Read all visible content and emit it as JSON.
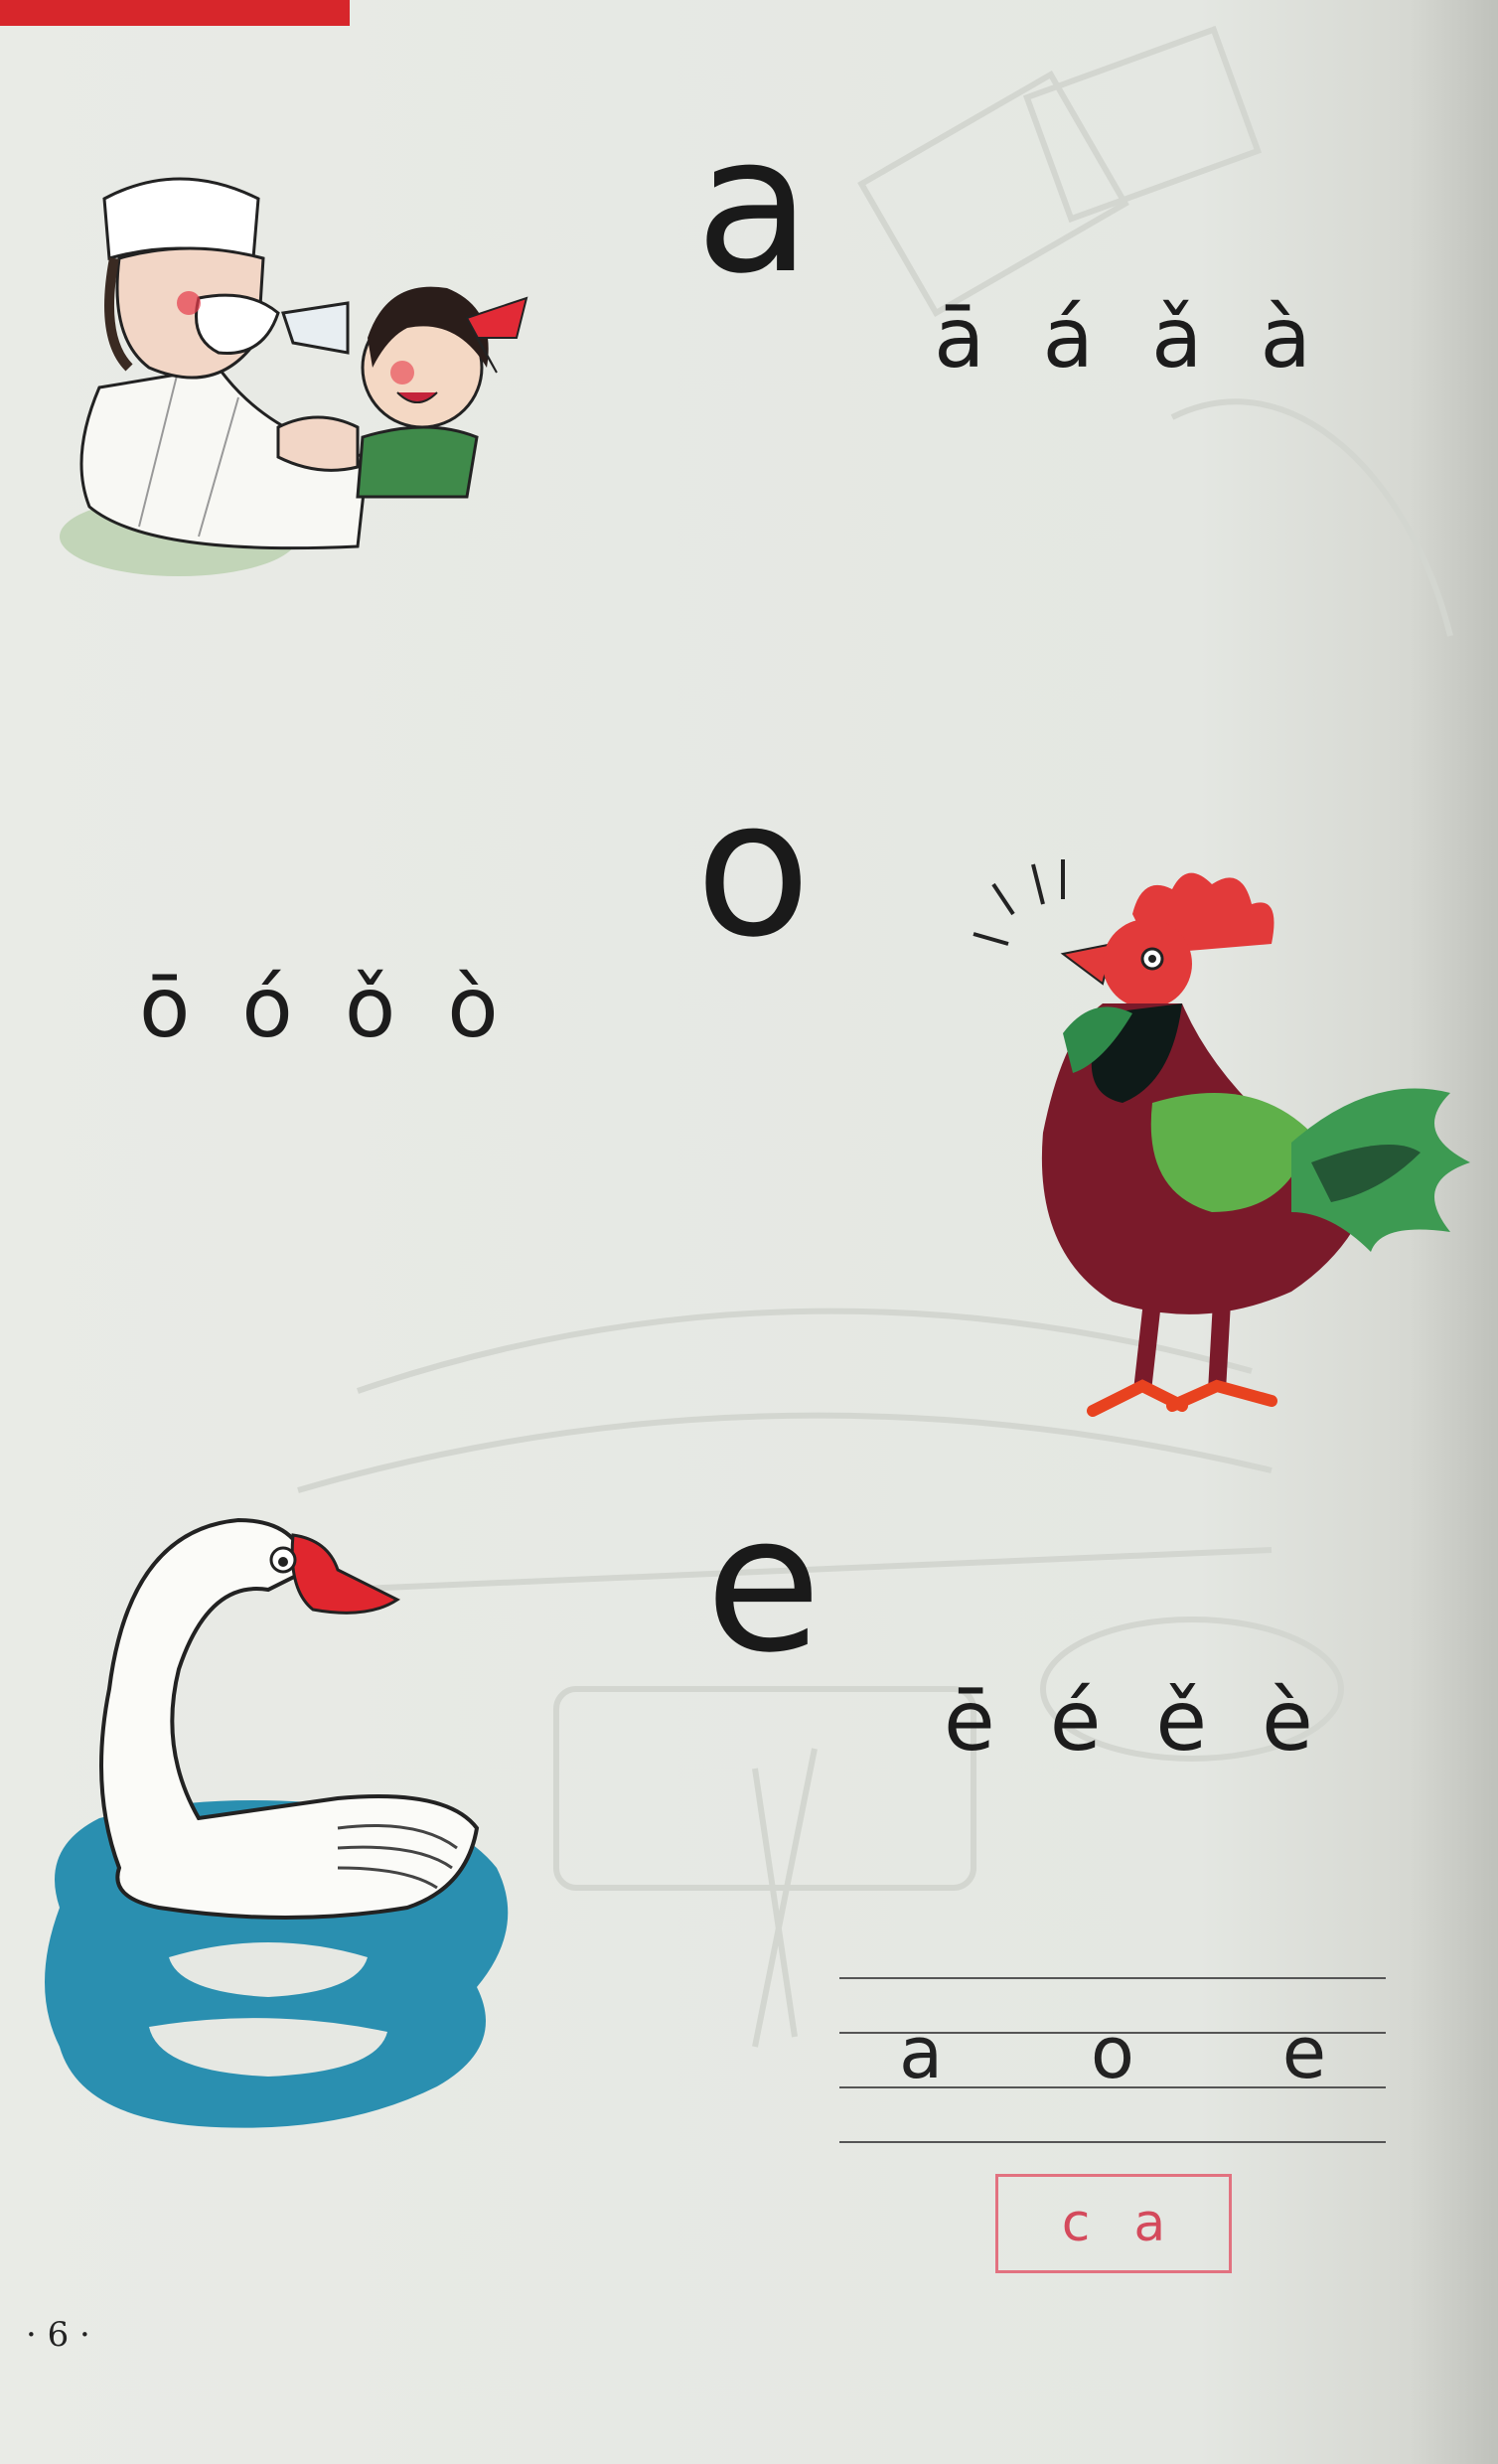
{
  "letters": {
    "a": {
      "main": "a",
      "tones": [
        "ā",
        "á",
        "ǎ",
        "à"
      ]
    },
    "o": {
      "main": "o",
      "tones": [
        "ō",
        "ó",
        "ǒ",
        "ò"
      ]
    },
    "e": {
      "main": "e",
      "tones": [
        "ē",
        "é",
        "ě",
        "è"
      ]
    }
  },
  "writing_lines": {
    "letters": [
      "a",
      "o",
      "e"
    ]
  },
  "syllable_box": {
    "letters": [
      "c",
      "a"
    ]
  },
  "page_number": "· 6 ·",
  "colors": {
    "accent_red": "#d7262b",
    "box_pink": "#e27280",
    "water_blue": "#2a8fb0"
  },
  "illustrations": [
    "doctor-and-girl",
    "rooster",
    "goose-on-water"
  ]
}
